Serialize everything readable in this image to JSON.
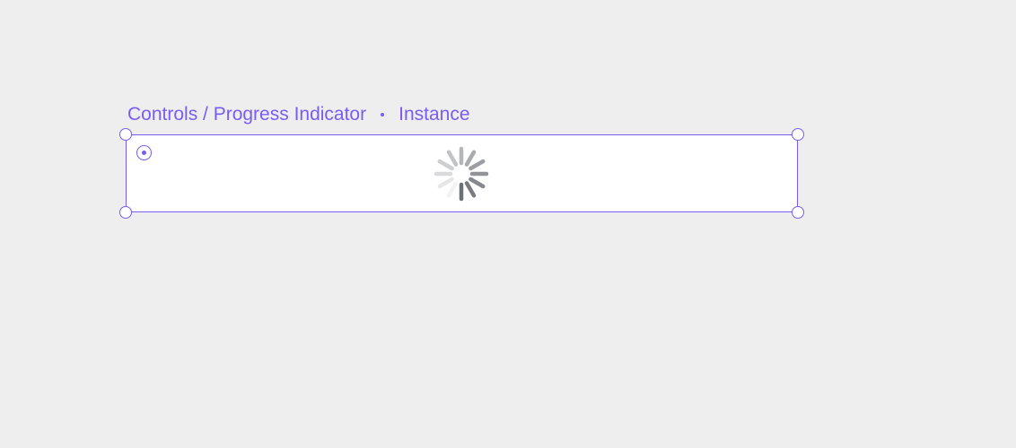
{
  "selection": {
    "component_path": "Controls / Progress Indicator",
    "kind": "Instance"
  },
  "icons": {
    "instance": "instance-icon",
    "spinner": "progress-spinner-icon"
  },
  "colors": {
    "canvas_background": "#eeeeee",
    "selection_accent": "#7b5cf0",
    "frame_background": "#ffffff",
    "spinner_segment": "#6e7077"
  },
  "spinner": {
    "segment_count": 12
  }
}
